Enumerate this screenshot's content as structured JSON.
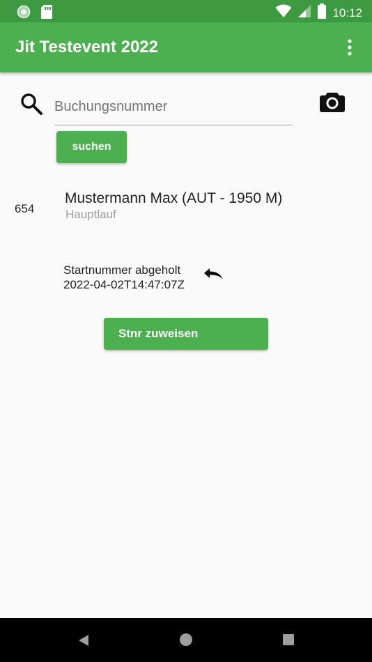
{
  "status_bar": {
    "time": "10:12",
    "icons": [
      "app-notification-icon",
      "sd-card-icon",
      "wifi-icon",
      "signal-icon",
      "battery-icon"
    ]
  },
  "app_bar": {
    "title": "Jit Testevent 2022",
    "menu_icon": "more-vert-icon"
  },
  "search": {
    "placeholder": "Buchungsnummer",
    "button_label": "suchen",
    "search_icon": "search-icon",
    "camera_icon": "camera-icon"
  },
  "result": {
    "number": "654",
    "name": "Mustermann Max (AUT - 1950 M)",
    "subtitle": "Hauptlauf",
    "status_label": "Startnummer abgeholt",
    "status_timestamp": "2022-04-02T14:47:07Z",
    "undo_icon": "undo-icon",
    "assign_label": "Stnr zuweisen"
  },
  "nav_bar": {
    "icons": [
      "back-icon",
      "home-icon",
      "recents-icon"
    ]
  },
  "colors": {
    "primary": "#4caf50",
    "primary_dark": "#3d9a41",
    "background": "#fafafa"
  }
}
